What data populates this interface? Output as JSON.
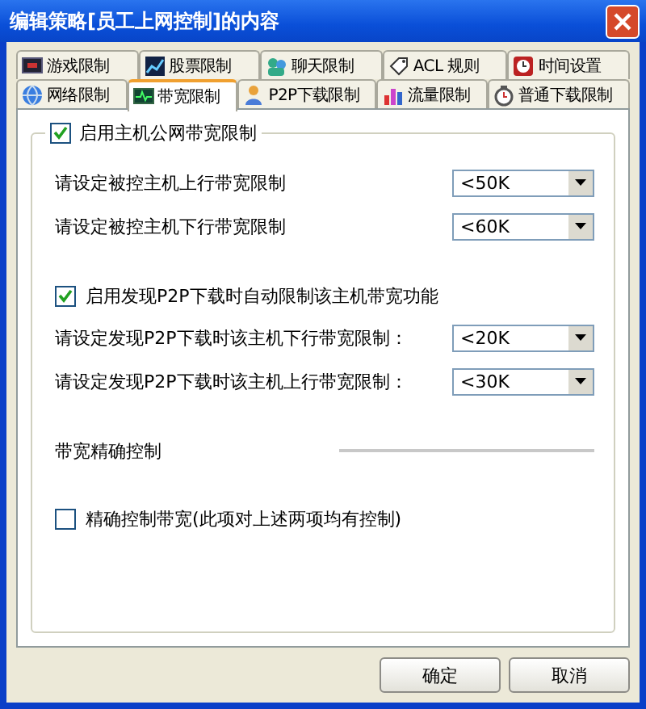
{
  "window": {
    "title": "编辑策略[员工上网控制]的内容"
  },
  "tab_rows": [
    [
      {
        "label": "游戏限制",
        "selected": false
      },
      {
        "label": "股票限制",
        "selected": false
      },
      {
        "label": "聊天限制",
        "selected": false
      },
      {
        "label": "ACL 规则",
        "selected": false
      },
      {
        "label": "时间设置",
        "selected": false
      }
    ],
    [
      {
        "label": "网络限制",
        "selected": false
      },
      {
        "label": "带宽限制",
        "selected": true
      },
      {
        "label": "P2P下载限制",
        "selected": false
      },
      {
        "label": "流量限制",
        "selected": false
      },
      {
        "label": "普通下载限制",
        "selected": false
      }
    ]
  ],
  "group": {
    "label": "启用主机公网带宽限制",
    "checked": true,
    "rows": [
      {
        "kind": "select",
        "label": "请设定被控主机上行带宽限制",
        "value": "<50K"
      },
      {
        "kind": "select",
        "label": "请设定被控主机下行带宽限制",
        "value": "<60K"
      },
      {
        "kind": "checkbox",
        "label": "启用发现P2P下载时自动限制该主机带宽功能",
        "checked": true
      },
      {
        "kind": "select",
        "label": "请设定发现P2P下载时该主机下行带宽限制：",
        "value": "<20K"
      },
      {
        "kind": "select",
        "label": "请设定发现P2P下载时该主机上行带宽限制：",
        "value": "<30K"
      },
      {
        "kind": "slider",
        "label": "带宽精确控制"
      },
      {
        "kind": "checkbox",
        "label": "精确控制带宽(此项对上述两项均有控制)",
        "checked": false
      }
    ]
  },
  "buttons": [
    "确定",
    "取消"
  ]
}
